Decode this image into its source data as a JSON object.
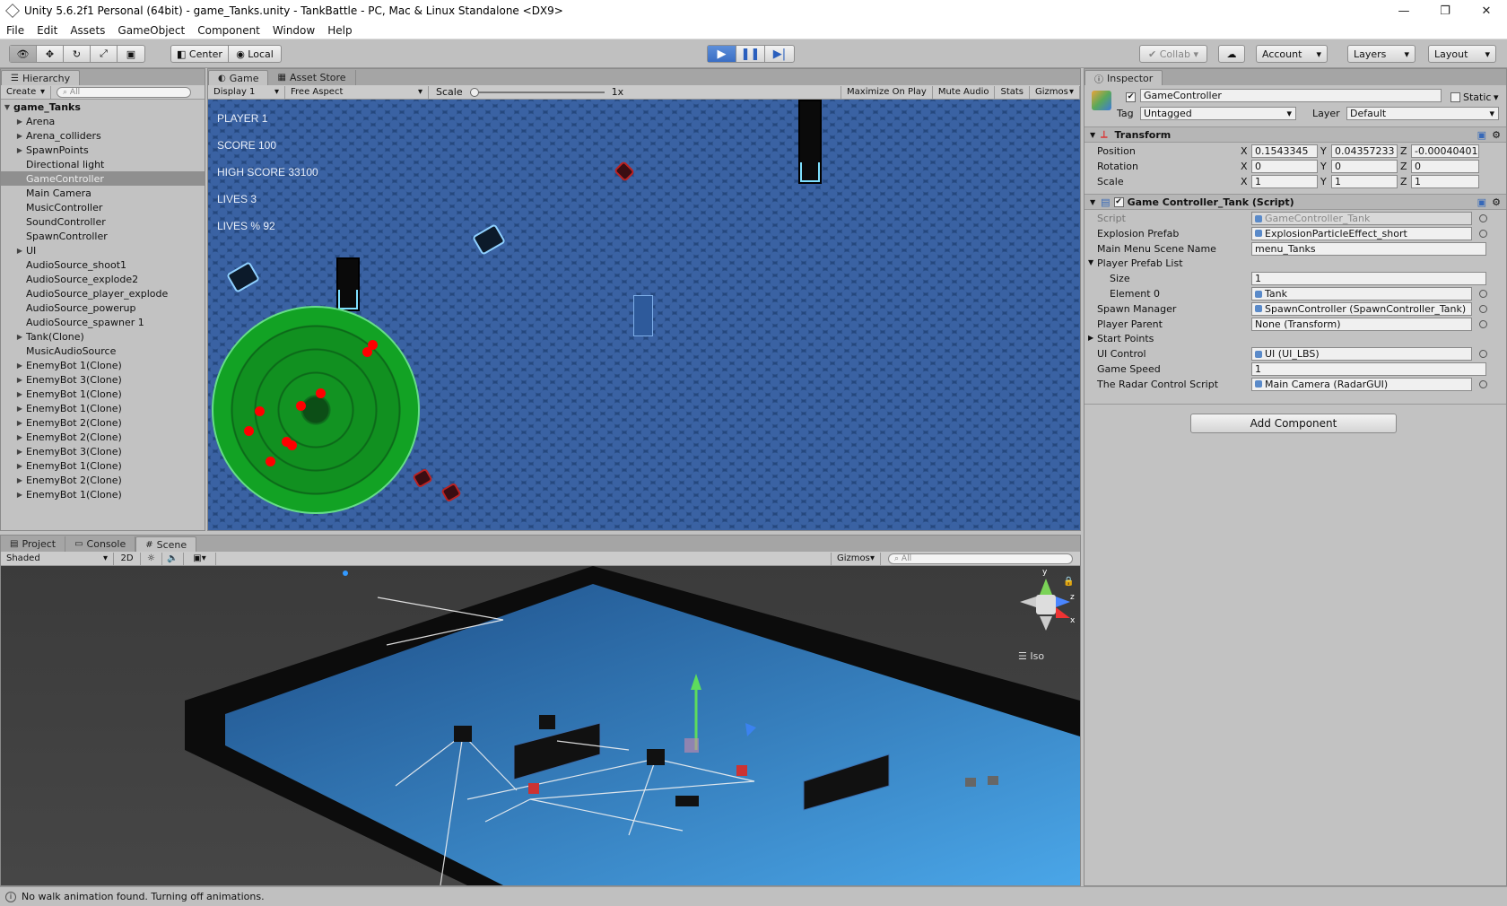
{
  "window": {
    "title": "Unity 5.6.2f1 Personal (64bit) - game_Tanks.unity - TankBattle - PC, Mac & Linux Standalone <DX9>"
  },
  "menu": [
    "File",
    "Edit",
    "Assets",
    "GameObject",
    "Component",
    "Window",
    "Help"
  ],
  "toolbar": {
    "pivot": "Center",
    "space": "Local",
    "collab": "Collab",
    "account": "Account",
    "layers": "Layers",
    "layout": "Layout"
  },
  "hierarchy": {
    "tab": "Hierarchy",
    "create": "Create",
    "search_placeholder": "All",
    "root": "game_Tanks",
    "items": [
      {
        "label": "Arena",
        "arrow": true
      },
      {
        "label": "Arena_colliders",
        "arrow": true
      },
      {
        "label": "SpawnPoints",
        "arrow": true
      },
      {
        "label": "Directional light",
        "arrow": false
      },
      {
        "label": "GameController",
        "arrow": false,
        "selected": true
      },
      {
        "label": "Main Camera",
        "arrow": false
      },
      {
        "label": "MusicController",
        "arrow": false
      },
      {
        "label": "SoundController",
        "arrow": false
      },
      {
        "label": "SpawnController",
        "arrow": false
      },
      {
        "label": "UI",
        "arrow": true
      },
      {
        "label": "AudioSource_shoot1",
        "arrow": false
      },
      {
        "label": "AudioSource_explode2",
        "arrow": false
      },
      {
        "label": "AudioSource_player_explode",
        "arrow": false
      },
      {
        "label": "AudioSource_powerup",
        "arrow": false
      },
      {
        "label": "AudioSource_spawner 1",
        "arrow": false
      },
      {
        "label": "Tank(Clone)",
        "arrow": true
      },
      {
        "label": "MusicAudioSource",
        "arrow": false
      },
      {
        "label": "EnemyBot 1(Clone)",
        "arrow": true
      },
      {
        "label": "EnemyBot 3(Clone)",
        "arrow": true
      },
      {
        "label": "EnemyBot 1(Clone)",
        "arrow": true
      },
      {
        "label": "EnemyBot 1(Clone)",
        "arrow": true
      },
      {
        "label": "EnemyBot 2(Clone)",
        "arrow": true
      },
      {
        "label": "EnemyBot 2(Clone)",
        "arrow": true
      },
      {
        "label": "EnemyBot 3(Clone)",
        "arrow": true
      },
      {
        "label": "EnemyBot 1(Clone)",
        "arrow": true
      },
      {
        "label": "EnemyBot 2(Clone)",
        "arrow": true
      },
      {
        "label": "EnemyBot 1(Clone)",
        "arrow": true
      }
    ]
  },
  "game": {
    "tab": "Game",
    "store_tab": "Asset Store",
    "display": "Display 1",
    "aspect": "Free Aspect",
    "scale_label": "Scale",
    "scale_value": "1x",
    "maximize": "Maximize On Play",
    "mute": "Mute Audio",
    "stats": "Stats",
    "gizmos": "Gizmos",
    "hud": [
      "PLAYER 1",
      "SCORE 100",
      "HIGH SCORE 33100",
      "LIVES 3",
      "LIVES % 92"
    ]
  },
  "bottom": {
    "project": "Project",
    "console": "Console",
    "scene": "Scene",
    "shaded": "Shaded",
    "mode2d": "2D",
    "gizmos": "Gizmos",
    "search_placeholder": "All",
    "iso": "Iso",
    "axes": {
      "y": "y",
      "z": "z",
      "x": "x"
    }
  },
  "inspector": {
    "tab": "Inspector",
    "object_name": "GameController",
    "static_label": "Static",
    "tag_label": "Tag",
    "tag_value": "Untagged",
    "layer_label": "Layer",
    "layer_value": "Default",
    "transform": {
      "title": "Transform",
      "position": {
        "label": "Position",
        "x": "0.1543345",
        "y": "0.04357233",
        "z": "-0.00040401!"
      },
      "rotation": {
        "label": "Rotation",
        "x": "0",
        "y": "0",
        "z": "0"
      },
      "scale": {
        "label": "Scale",
        "x": "1",
        "y": "1",
        "z": "1"
      }
    },
    "script": {
      "title": "Game Controller_Tank (Script)",
      "fields": [
        {
          "label": "Script",
          "value": "GameController_Tank",
          "obj": true,
          "dim": true
        },
        {
          "label": "Explosion Prefab",
          "value": "ExplosionParticleEffect_short",
          "obj": true
        },
        {
          "label": "Main Menu Scene Name",
          "value": "menu_Tanks"
        },
        {
          "label": "Player Prefab List",
          "header": true
        },
        {
          "label": "Size",
          "value": "1",
          "indent": true
        },
        {
          "label": "Element 0",
          "value": "Tank",
          "obj": true,
          "indent": true
        },
        {
          "label": "Spawn Manager",
          "value": "SpawnController (SpawnController_Tank)",
          "obj": true
        },
        {
          "label": "Player Parent",
          "value": "None (Transform)",
          "circ": true
        },
        {
          "label": "Start Points",
          "header": true,
          "collapsed": true
        },
        {
          "label": "UI Control",
          "value": "UI (UI_LBS)",
          "obj": true
        },
        {
          "label": "Game Speed",
          "value": "1"
        },
        {
          "label": "The Radar Control Script",
          "value": "Main Camera (RadarGUI)",
          "obj": true
        }
      ]
    },
    "add_component": "Add Component"
  },
  "status": {
    "message": "No walk animation found. Turning off animations."
  },
  "colors": {
    "play_active": "#3a6ec4",
    "radar": "#119020",
    "blip": "#ff0000",
    "game_bg": "#25487e",
    "accent": "#7fe0ff"
  }
}
